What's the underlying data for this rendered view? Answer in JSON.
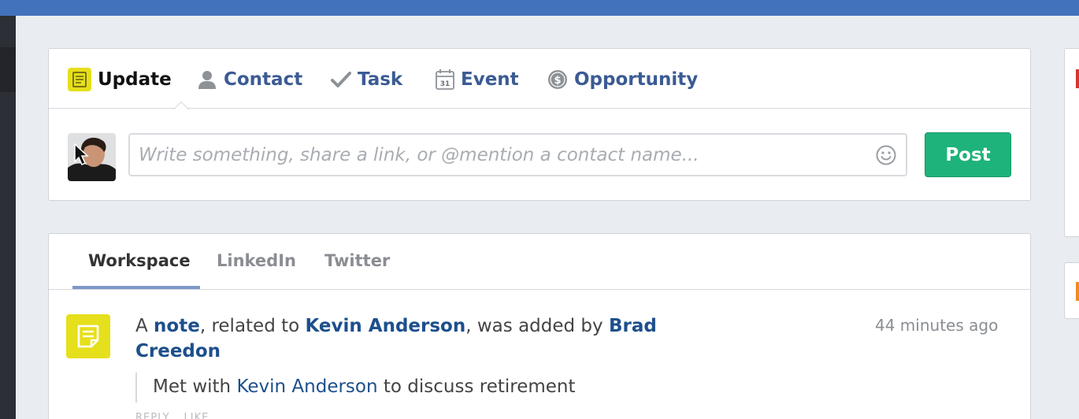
{
  "composer": {
    "tabs": [
      {
        "label": "Update",
        "icon": "note-icon"
      },
      {
        "label": "Contact",
        "icon": "person-icon"
      },
      {
        "label": "Task",
        "icon": "checkmark-icon"
      },
      {
        "label": "Event",
        "icon": "calendar-icon"
      },
      {
        "label": "Opportunity",
        "icon": "dollar-coin-icon"
      }
    ],
    "calendar_day": "31",
    "placeholder": "Write something, share a link, or @mention a contact name...",
    "post_label": "Post"
  },
  "feed": {
    "tabs": [
      {
        "label": "Workspace"
      },
      {
        "label": "LinkedIn"
      },
      {
        "label": "Twitter"
      }
    ],
    "item": {
      "prefix": "A ",
      "object_link": "note",
      "middle": ", related to ",
      "contact_link": "Kevin Anderson",
      "suffix": ", was added by ",
      "author_link": "Brad Creedon",
      "timestamp": "44 minutes ago",
      "quote_prefix": "Met with ",
      "quote_link": "Kevin Anderson",
      "quote_suffix": " to discuss retirement",
      "action_reply": "REPLY",
      "action_like": "LIKE"
    }
  },
  "colors": {
    "top_bar": "#4272bb",
    "link": "#1d4f8c",
    "tab_link": "#3b5b93",
    "post_button": "#1eb37a",
    "note_yellow": "#e6df1c",
    "side_accent_red": "#d9342b",
    "side_accent_orange": "#f08a24"
  }
}
